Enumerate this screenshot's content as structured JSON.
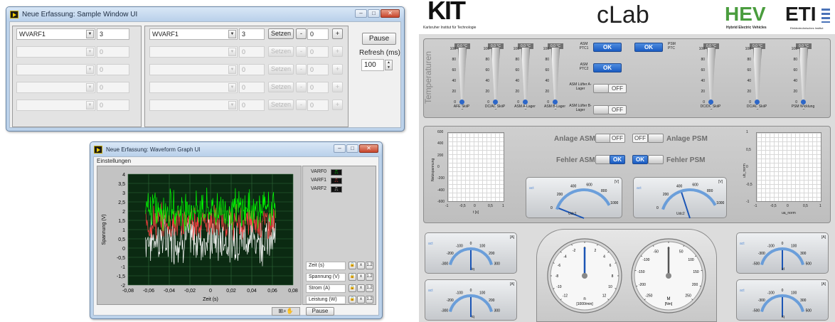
{
  "sample_window": {
    "title": "Neue Erfassung: Sample Window UI",
    "row1": {
      "left_select": "WVARF1",
      "left_value": "3",
      "right_select": "WVARF1",
      "right_value": "3",
      "set_label": "Setzen",
      "minus": "-",
      "set_value": "0",
      "plus": "+"
    },
    "disabled_value": "0",
    "disabled_set_label": "Setzen",
    "disabled_set_value": "0",
    "pause_label": "Pause",
    "refresh_label": "Refresh (ms)",
    "refresh_value": "100"
  },
  "waveform_window": {
    "title": "Neue Erfassung: Waveform Graph UI",
    "menu": "Einstellungen",
    "ylabel": "Spannung (V)",
    "xlabel": "Zeit (s)",
    "legend": [
      "VARF0",
      "VARF1",
      "VARF2"
    ],
    "scales": [
      "Zeit (s)",
      "Spannung (V)",
      "Strom (A)",
      "Leistung (W)"
    ],
    "pause_label": "Pause",
    "chart_data": {
      "type": "line",
      "ylim": [
        -2,
        4
      ],
      "xlim": [
        -0.08,
        0.08
      ],
      "yticks": [
        "4",
        "3,5",
        "3",
        "2,5",
        "2",
        "1,5",
        "1",
        "0,5",
        "0",
        "-0,5",
        "-1",
        "-1,5",
        "-2"
      ],
      "xticks": [
        "-0,08",
        "-0,06",
        "-0,04",
        "-0,02",
        "0",
        "0,02",
        "0,04",
        "0,06",
        "0,08"
      ],
      "series": [
        {
          "name": "VARF0",
          "color": "#00ff00",
          "center": 2.1,
          "spread": 0.9
        },
        {
          "name": "VARF1",
          "color": "#ff4040",
          "center": 1.4,
          "spread": 0.8
        },
        {
          "name": "VARF2",
          "color": "#ffffff",
          "center": 0.5,
          "spread": 1.1
        }
      ],
      "x_range_data": [
        -0.063,
        0.063
      ]
    }
  },
  "clab": {
    "logo_kit": "KIT",
    "kit_sub": "Karlsruher Institut für Technologie",
    "title": "cLab",
    "hev": "HEV",
    "hev_sub": "Hybrid Electric Vehicles",
    "eti": "ETI",
    "eti_sub": "Elektrotechnisches Institut",
    "temp_label": "Temperaturen",
    "therm_head": "0,0 °C",
    "therm_ticks": [
      "100",
      "80",
      "60",
      "40",
      "20",
      "0"
    ],
    "therms": [
      "AFE SkiiP",
      "DC/AC SkiiP",
      "ASM A-Lager",
      "ASM B-Lager",
      "DC/DC SkiiP",
      "DC/AC SkiiP",
      "PSM Wicklung"
    ],
    "asm_ptc1": "ASM PTC1",
    "asm_ptc2": "ASM PTC2",
    "psm_ptc": "PSM PTC",
    "luefter_a": "ASM Lüfter A-Lager",
    "luefter_b": "ASM Lüfter B-Lager",
    "ok": "OK",
    "off": "OFF",
    "anlage_asm": "Anlage ASM",
    "anlage_psm": "Anlage PSM",
    "fehler_asm": "Fehler ASM",
    "fehler_psm": "Fehler PSM",
    "xy_left": {
      "ylabel": "Netzspannung",
      "xlabel": "t [s]",
      "yticks": [
        "600",
        "400",
        "200",
        "0",
        "-200",
        "-400",
        "-600"
      ],
      "xticks": [
        "-1",
        "-0,5",
        "0",
        "0,5",
        "1"
      ]
    },
    "xy_right": {
      "ylabel": "ub_norm",
      "xlabel": "ua_norm",
      "yticks": [
        "1",
        "0,5",
        "0",
        "-0,5",
        "-1"
      ],
      "xticks": [
        "-1",
        "-0,5",
        "0",
        "0,5",
        "1"
      ]
    },
    "udc1": "Udc1",
    "udc2": "Udc2",
    "v_unit": "[V]",
    "a_unit": "[A]",
    "act": "act",
    "udc_ticks": [
      "0",
      "200",
      "400",
      "600",
      "800",
      "1000"
    ],
    "i_ticks": [
      "-300",
      "-200",
      "-100",
      "0",
      "100",
      "200",
      "300"
    ],
    "i_ticks2": [
      "-500",
      "-300",
      "-100",
      "0",
      "100",
      "300",
      "500"
    ],
    "iq": "iq",
    "id": "id",
    "n_label": "n",
    "n_unit": "[1000/min]",
    "n_ticks": [
      "-12",
      "-10",
      "-8",
      "-6",
      "-4",
      "-2",
      "0",
      "2",
      "4",
      "6",
      "8",
      "10",
      "12"
    ],
    "m_label": "M",
    "m_unit": "[Nm]",
    "m_ticks": [
      "-250",
      "-200",
      "-150",
      "-100",
      "-50",
      "0",
      "50",
      "100",
      "150",
      "200",
      "250"
    ]
  }
}
